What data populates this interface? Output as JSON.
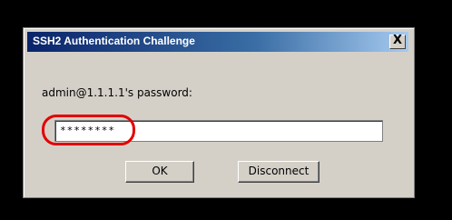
{
  "window": {
    "title": "SSH2 Authentication Challenge",
    "close_label": "X"
  },
  "prompt": {
    "label": "admin@1.1.1.1's password:"
  },
  "password": {
    "value": "********"
  },
  "buttons": {
    "ok_label": "OK",
    "disconnect_label": "Disconnect"
  },
  "colors": {
    "highlight": "#e20000",
    "title_bar": "#0a246a",
    "dialog_bg": "#d4d0c8"
  }
}
